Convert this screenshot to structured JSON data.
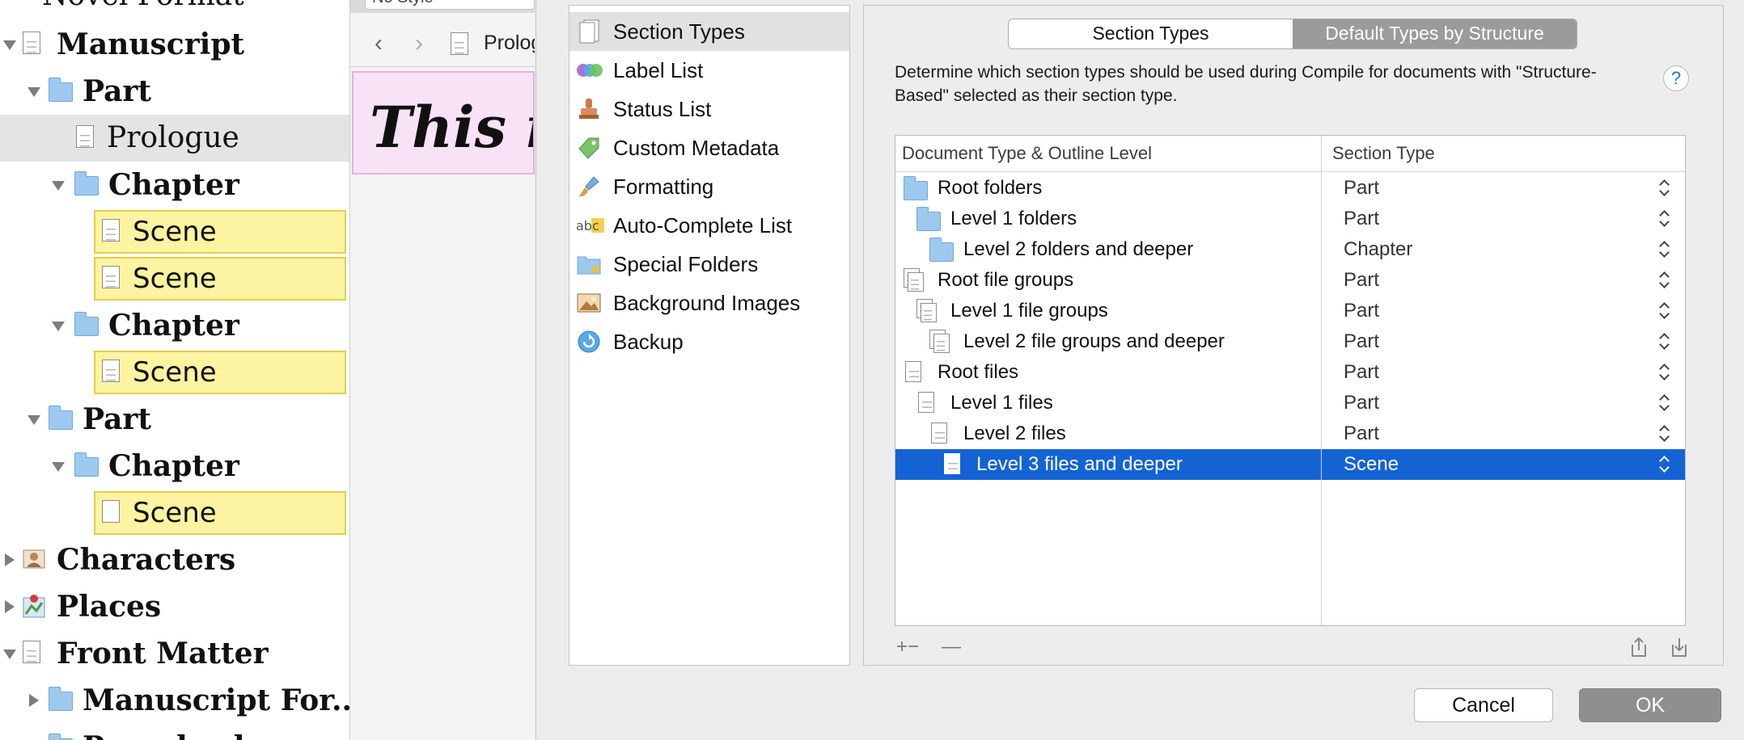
{
  "binder": {
    "top_partial": "Novel Format",
    "items": [
      {
        "label": "Manuscript"
      },
      {
        "label": "Part"
      },
      {
        "label": "Prologue"
      },
      {
        "label": "Chapter"
      },
      {
        "label": "Scene"
      },
      {
        "label": "Scene"
      },
      {
        "label": "Chapter"
      },
      {
        "label": "Scene"
      },
      {
        "label": "Part"
      },
      {
        "label": "Chapter"
      },
      {
        "label": "Scene"
      },
      {
        "label": "Characters"
      },
      {
        "label": "Places"
      },
      {
        "label": "Front Matter"
      },
      {
        "label": "Manuscript For..."
      },
      {
        "label": "Paperback"
      }
    ]
  },
  "editor": {
    "style_value": "No Style",
    "breadcrumb": "Prolog",
    "text_preview": "This is"
  },
  "sidebar": {
    "items": [
      {
        "label": "Section Types",
        "icon": "section-types-icon"
      },
      {
        "label": "Label List",
        "icon": "label-list-icon"
      },
      {
        "label": "Status List",
        "icon": "status-stamp-icon"
      },
      {
        "label": "Custom Metadata",
        "icon": "tag-icon"
      },
      {
        "label": "Formatting",
        "icon": "brush-icon"
      },
      {
        "label": "Auto-Complete List",
        "icon": "abc-icon"
      },
      {
        "label": "Special Folders",
        "icon": "star-folder-icon"
      },
      {
        "label": "Background Images",
        "icon": "picture-icon"
      },
      {
        "label": "Backup",
        "icon": "backup-icon"
      }
    ]
  },
  "panel": {
    "tabs": [
      "Section Types",
      "Default Types by Structure"
    ],
    "description": "Determine which section types should be used during Compile for documents with \"Structure-Based\" selected as their section type.",
    "help": "?",
    "columns": [
      "Document Type & Outline Level",
      "Section Type"
    ],
    "rows": [
      {
        "label": "Root folders",
        "value": "Part"
      },
      {
        "label": "Level 1 folders",
        "value": "Part"
      },
      {
        "label": "Level 2 folders and deeper",
        "value": "Chapter"
      },
      {
        "label": "Root file groups",
        "value": "Part"
      },
      {
        "label": "Level 1 file groups",
        "value": "Part"
      },
      {
        "label": "Level 2 file groups and deeper",
        "value": "Part"
      },
      {
        "label": "Root files",
        "value": "Part"
      },
      {
        "label": "Level 1 files",
        "value": "Part"
      },
      {
        "label": "Level 2 files",
        "value": "Part"
      },
      {
        "label": "Level 3 files and deeper",
        "value": "Scene"
      }
    ],
    "footer": {
      "add": "+−",
      "remove": "—"
    }
  },
  "buttons": {
    "cancel": "Cancel",
    "ok": "OK"
  },
  "colors": {
    "selection": "#1463d4",
    "scene_highlight": "#fdf4a2",
    "folder": "#9ec9ee"
  }
}
